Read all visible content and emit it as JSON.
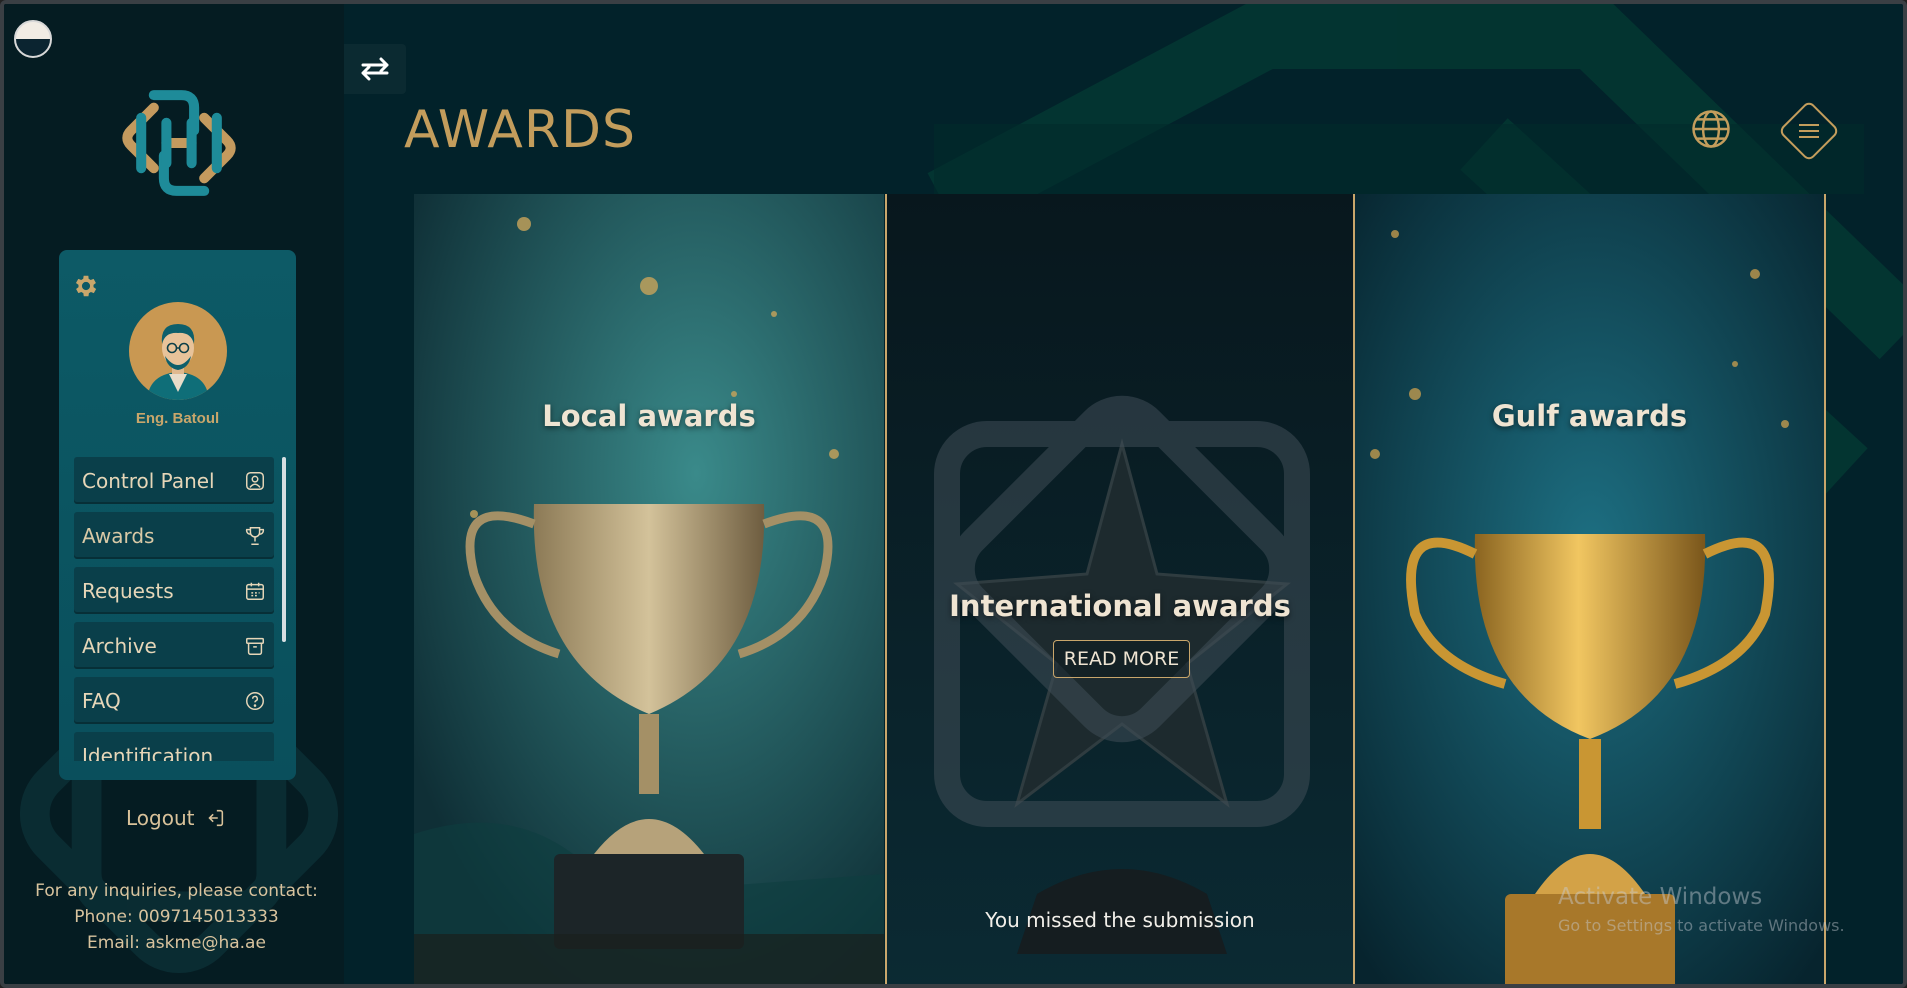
{
  "sidebar": {
    "user_name": "Eng. Batoul",
    "menu": [
      {
        "label": "Control Panel",
        "icon": "user-square-icon"
      },
      {
        "label": "Awards",
        "icon": "trophy-icon"
      },
      {
        "label": "Requests",
        "icon": "calendar-icon"
      },
      {
        "label": "Archive",
        "icon": "archive-box-icon"
      },
      {
        "label": "FAQ",
        "icon": "question-circle-icon"
      },
      {
        "label": "Identification",
        "icon": "id-icon"
      }
    ],
    "logout_label": "Logout",
    "contact": {
      "line1": "For any inquiries, please contact:",
      "phone": "Phone: 0097145013333",
      "email": "Email: askme@ha.ae"
    }
  },
  "header": {
    "title": "AWARDS"
  },
  "cards": [
    {
      "title": "Local awards"
    },
    {
      "title": "International awards",
      "button_label": "READ MORE",
      "status": "You missed the submission"
    },
    {
      "title": "Gulf awards"
    }
  ],
  "watermark": {
    "line1": "Activate Windows",
    "line2": "Go to Settings to activate Windows."
  },
  "colors": {
    "gold": "#c39d5c",
    "teal_panel": "#0b5561",
    "background": "#031b22"
  }
}
